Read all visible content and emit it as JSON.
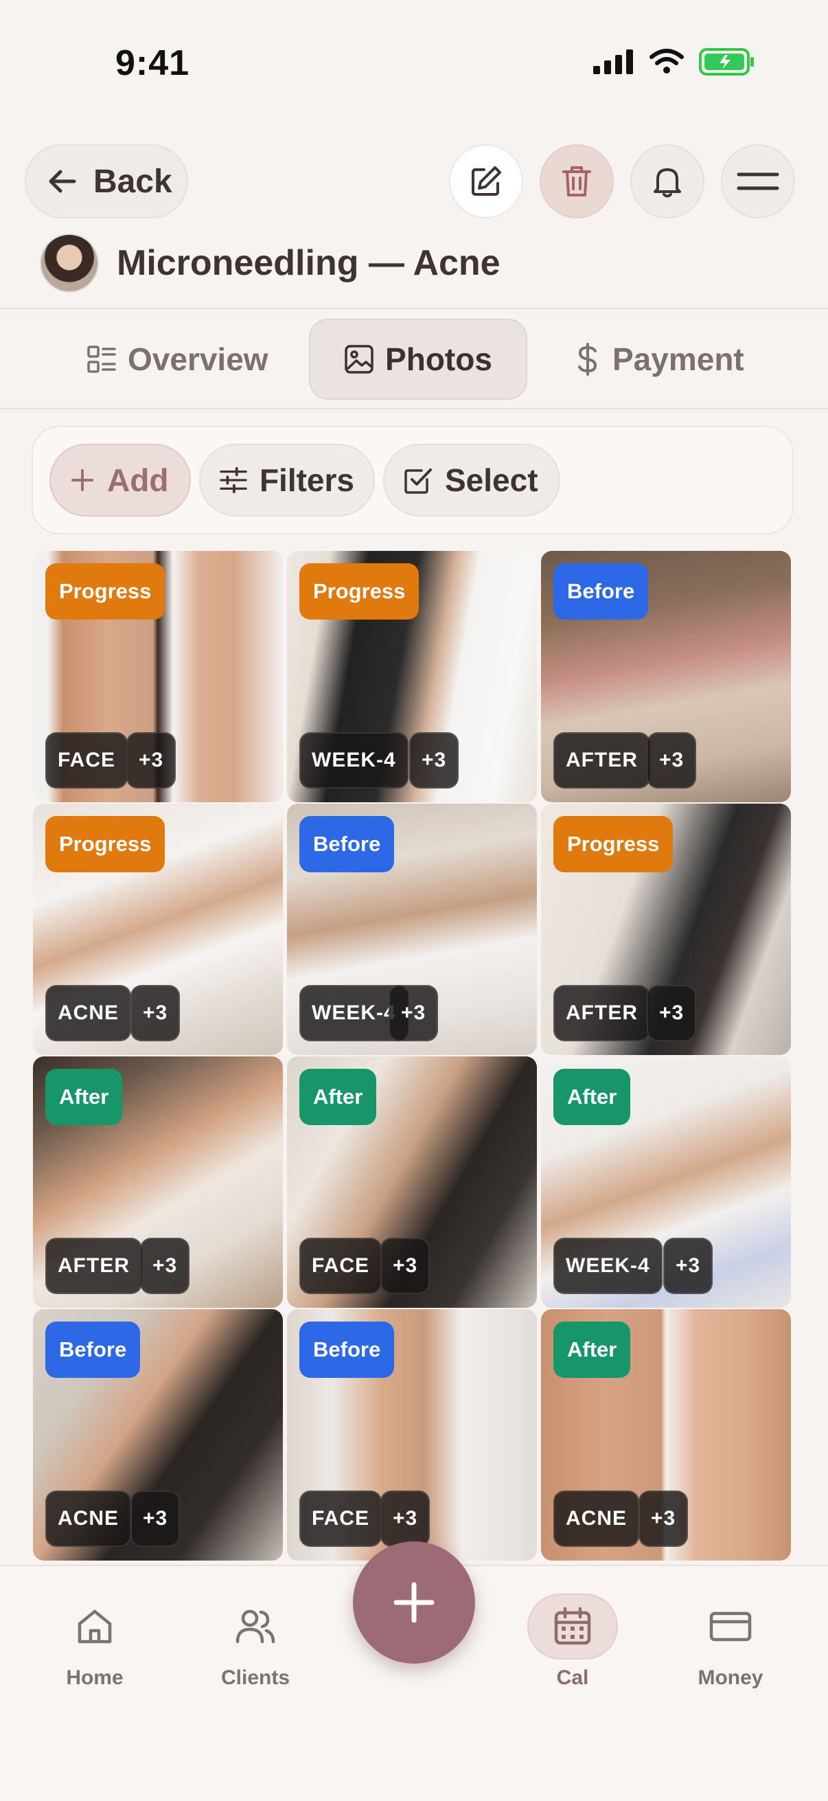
{
  "status_bar": {
    "time": "9:41"
  },
  "header": {
    "back_label": "Back",
    "title": "Microneedling — Acne",
    "icons": [
      "arrow-left-icon",
      "edit-icon",
      "trash-icon",
      "bell-icon",
      "menu-icon"
    ]
  },
  "tabs": [
    {
      "label": "Overview",
      "icon": "overview-icon",
      "active": false
    },
    {
      "label": "Photos",
      "icon": "photo-icon",
      "active": true
    },
    {
      "label": "Payment",
      "icon": "dollar-icon",
      "active": false
    }
  ],
  "toolbar": {
    "add_label": "Add",
    "filters_label": "Filters",
    "select_label": "Select"
  },
  "photos": [
    {
      "badge": "Progress",
      "badge_type": "progress",
      "tag": "FACE",
      "count": "+3"
    },
    {
      "badge": "Progress",
      "badge_type": "progress",
      "tag": "WEEK-4",
      "count": "+3"
    },
    {
      "badge": "Before",
      "badge_type": "before",
      "tag": "AFTER",
      "count": "+3"
    },
    {
      "badge": "Progress",
      "badge_type": "progress",
      "tag": "ACNE",
      "count": "+3"
    },
    {
      "badge": "Before",
      "badge_type": "before",
      "tag": "WEEK-4",
      "count": "+3"
    },
    {
      "badge": "Progress",
      "badge_type": "progress",
      "tag": "AFTER",
      "count": "+3"
    },
    {
      "badge": "After",
      "badge_type": "after",
      "tag": "AFTER",
      "count": "+3"
    },
    {
      "badge": "After",
      "badge_type": "after",
      "tag": "FACE",
      "count": "+3"
    },
    {
      "badge": "After",
      "badge_type": "after",
      "tag": "WEEK-4",
      "count": "+3"
    },
    {
      "badge": "Before",
      "badge_type": "before",
      "tag": "ACNE",
      "count": "+3"
    },
    {
      "badge": "Before",
      "badge_type": "before",
      "tag": "FACE",
      "count": "+3"
    },
    {
      "badge": "After",
      "badge_type": "after",
      "tag": "ACNE",
      "count": "+3"
    }
  ],
  "nav": [
    {
      "label": "Home",
      "icon": "home-icon",
      "active": false
    },
    {
      "label": "Clients",
      "icon": "users-icon",
      "active": false
    },
    {
      "label": "Cal",
      "icon": "calendar-icon",
      "active": true
    },
    {
      "label": "Money",
      "icon": "card-icon",
      "active": false
    }
  ],
  "fab_icon": "plus-icon",
  "colors": {
    "accent": "#9c6b75",
    "progress": "#e07a0f",
    "before": "#2d68e6",
    "after": "#17966a",
    "background": "#f6f3f0"
  }
}
